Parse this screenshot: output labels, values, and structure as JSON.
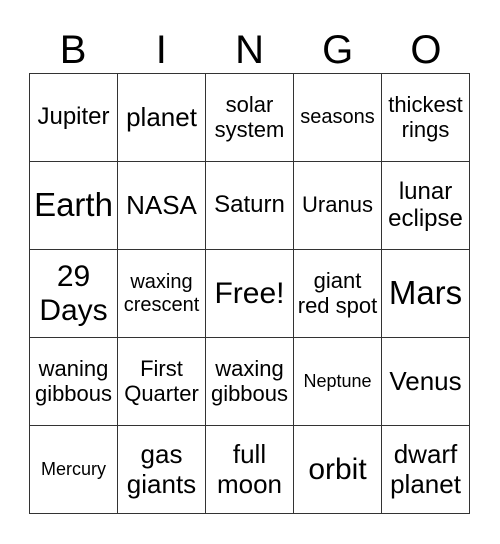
{
  "header": [
    "B",
    "I",
    "N",
    "G",
    "O"
  ],
  "cells": [
    [
      "Jupiter",
      "planet",
      "solar system",
      "seasons",
      "thickest rings"
    ],
    [
      "Earth",
      "NASA",
      "Saturn",
      "Uranus",
      "lunar eclipse"
    ],
    [
      "29 Days",
      "waxing crescent",
      "Free!",
      "giant red spot",
      "Mars"
    ],
    [
      "waning gibbous",
      "First Quarter",
      "waxing gibbous",
      "Neptune",
      "Venus"
    ],
    [
      "Mercury",
      "gas giants",
      "full moon",
      "orbit",
      "dwarf planet"
    ]
  ]
}
